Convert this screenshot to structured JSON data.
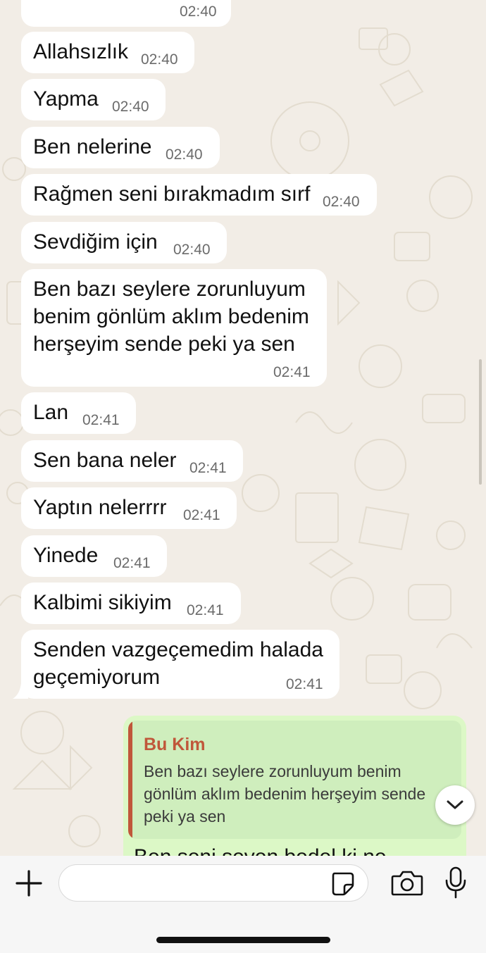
{
  "top_cut": {
    "time": "02:40"
  },
  "messages": [
    {
      "text": "Allahsızlık",
      "time": "02:40"
    },
    {
      "text": "Yapma",
      "time": "02:40"
    },
    {
      "text": "Ben nelerine",
      "time": "02:40"
    },
    {
      "text": "Rağmen seni bırakmadım sırf",
      "time": "02:40"
    },
    {
      "text": "Sevdiğim için",
      "time": "02:40"
    },
    {
      "lines": [
        "Ben bazı seylere zorunluyum",
        "benim gönlüm aklım bedenim",
        "herşeyim sende peki ya sen"
      ],
      "time": "02:41"
    },
    {
      "text": "Lan",
      "time": "02:41"
    },
    {
      "text": "Sen bana neler",
      "time": "02:41"
    },
    {
      "text": "Yaptın nelerrrr",
      "time": "02:41"
    },
    {
      "text": "Yinede",
      "time": "02:41"
    },
    {
      "text": "Kalbimi sikiyim",
      "time": "02:41"
    },
    {
      "lines": [
        "Senden vazgeçemedim halada",
        "geçemiyorum"
      ],
      "time": "02:41"
    }
  ],
  "reply": {
    "author": "Bu Kim",
    "quote": "Ben bazı seylere zorunluyum benim gönlüm aklım bedenim herşeyim sende peki ya sen",
    "partial_text": "Ben seni seven bedel ki ne"
  },
  "icons": {
    "plus": "plus-icon",
    "sticker": "sticker-icon",
    "camera": "camera-icon",
    "mic": "microphone-icon",
    "scroll": "chevron-down-icon"
  },
  "colors": {
    "background": "#f2ede6",
    "incoming": "#ffffff",
    "outgoing": "#dcf8c6",
    "quote_author": "#c0573a"
  }
}
